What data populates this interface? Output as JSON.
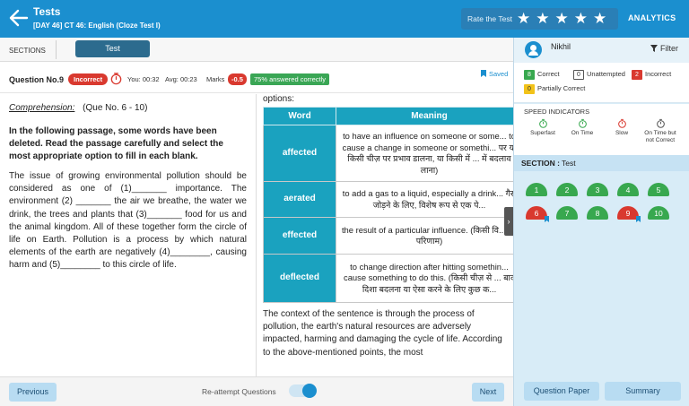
{
  "header": {
    "title": "Tests",
    "subtitle": "[DAY 46] CT 46: English (Cloze Test I)",
    "rate_label": "Rate the Test",
    "stars": [
      "★",
      "★",
      "★",
      "★",
      "★"
    ],
    "analytics": "ANALYTICS",
    "color": "#1b8fcf"
  },
  "sections_bar": {
    "label": "SECTIONS",
    "tab": "Test"
  },
  "question_bar": {
    "number": "Question No.9",
    "status": "Incorrect",
    "you": "You: 00:32",
    "avg": "Avg: 00:23",
    "marks_label": "Marks",
    "marks": "-0.5",
    "answered": "75% answered correctly",
    "saved": "Saved"
  },
  "passage": {
    "title": "Comprehension:",
    "range": "(Que No. 6 - 10)",
    "instruction": "In the following passage, some words have been deleted. Read the passage carefully and select the most appropriate option to fill in each blank.",
    "text": "The issue of growing environmental pollution should be considered as one of (1)_______ importance. The environment (2) _______ the air we breathe, the water we drink, the trees and plants that (3)_______ food for us and the animal kingdom. All of these together form the circle of life on Earth. Pollution is a process by which natural elements of the earth are negatively (4)________, causing harm and (5)________ to this circle of life."
  },
  "explanation": {
    "options_label": "options:",
    "headers": [
      "Word",
      "Meaning"
    ],
    "rows": [
      {
        "word": "affected",
        "meaning": "to have an influence on someone or some... to cause a change in someone or somethi... पर या किसी चीज़ पर प्रभाव डालना, या किसी में ... में बदलाव लाना)"
      },
      {
        "word": "aerated",
        "meaning": "to add a gas to a liquid, especially a drink... गैस जोड़ने के लिए, विशेष रूप से एक पे..."
      },
      {
        "word": "effected",
        "meaning": "the result of a particular influence. (किसी वि... का परिणाम)"
      },
      {
        "word": "deflected",
        "meaning": "to change direction after hitting somethin... cause something to do this. (किसी चीज़ से ... बाद दिशा बदलना या ऐसा करने के लिए कुछ क..."
      }
    ],
    "context": "The context of the sentence is through the process of pollution, the earth's natural resources are adversely impacted, harming and damaging the cycle of life. According to the above-mentioned points, the most"
  },
  "bottom_bar": {
    "previous": "Previous",
    "reattempt": "Re-attempt Questions",
    "next": "Next"
  },
  "sidebar": {
    "user_name": "Nikhil",
    "filter": "Filter",
    "legend": {
      "correct_count": "8",
      "correct": "Correct",
      "unattempted_count": "0",
      "unattempted": "Unattempted",
      "incorrect_count": "2",
      "incorrect": "Incorrect",
      "partial_count": "0",
      "partial": "Partially Correct"
    },
    "speed_title": "SPEED INDICATORS",
    "speed": [
      "Superfast",
      "On Time",
      "Slow",
      "On Time but not Correct"
    ],
    "section_label": "SECTION :",
    "section_name": "Test",
    "questions": [
      {
        "n": "1",
        "s": "g",
        "bm": false
      },
      {
        "n": "2",
        "s": "g",
        "bm": false
      },
      {
        "n": "3",
        "s": "g",
        "bm": false
      },
      {
        "n": "4",
        "s": "g",
        "bm": false
      },
      {
        "n": "5",
        "s": "g",
        "bm": false
      },
      {
        "n": "6",
        "s": "r",
        "bm": true
      },
      {
        "n": "7",
        "s": "g",
        "bm": false
      },
      {
        "n": "8",
        "s": "g",
        "bm": false
      },
      {
        "n": "9",
        "s": "r",
        "bm": true
      },
      {
        "n": "10",
        "s": "g",
        "bm": false
      }
    ],
    "question_paper": "Question Paper",
    "summary": "Summary"
  }
}
